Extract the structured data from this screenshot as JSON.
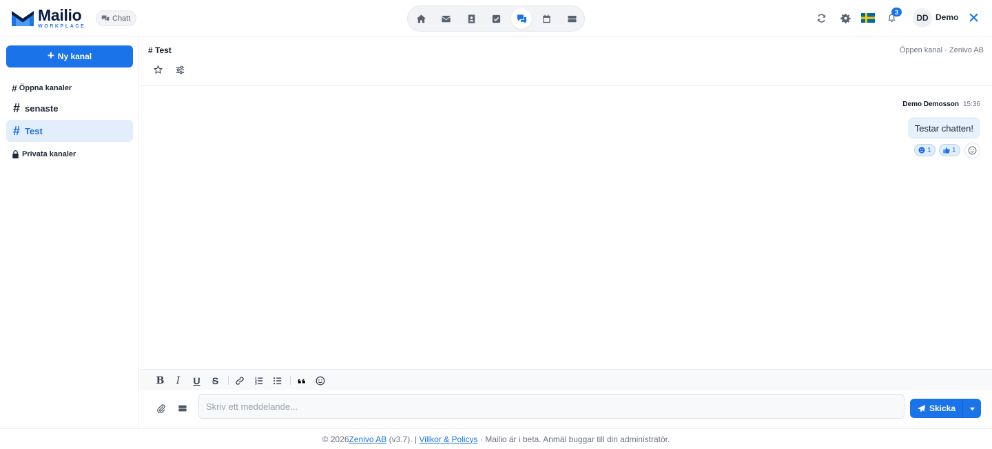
{
  "brand": {
    "name": "Mailio",
    "tagline": "WORKPLACE",
    "app_badge": "Chatt",
    "colors": {
      "primary": "#1a73e8",
      "brand_dark": "#0b1b3f"
    }
  },
  "nav": {
    "items": [
      {
        "id": "home",
        "icon": "home-icon"
      },
      {
        "id": "mail",
        "icon": "envelope-icon"
      },
      {
        "id": "contacts",
        "icon": "contacts-icon"
      },
      {
        "id": "tasks",
        "icon": "checkbox-icon"
      },
      {
        "id": "chat",
        "icon": "chat-bubbles-icon",
        "active": true
      },
      {
        "id": "calendar",
        "icon": "calendar-icon"
      },
      {
        "id": "storage",
        "icon": "storage-icon"
      }
    ]
  },
  "header_right": {
    "notification_count": "3",
    "language_flag": "flag-sweden-icon",
    "user": {
      "initials": "DD",
      "name": "Demo"
    }
  },
  "sidebar": {
    "new_channel_label": "Ny kanal",
    "open_section_label": "Öppna kanaler",
    "channels": [
      {
        "name": "senaste",
        "active": false
      },
      {
        "name": "Test",
        "active": true
      }
    ],
    "private_section_label": "Privata kanaler"
  },
  "channel": {
    "title": "# Test",
    "meta": "Öppen kanal · Zenivo AB"
  },
  "messages": [
    {
      "author": "Demo Demosson",
      "time": "15:36",
      "text": "Testar chatten!",
      "reactions": [
        {
          "icon": "smiley-icon",
          "count": "1"
        },
        {
          "icon": "thumbs-up-icon",
          "count": "1"
        }
      ]
    }
  ],
  "composer": {
    "placeholder": "Skriv ett meddelande...",
    "send_label": "Skicka"
  },
  "footer": {
    "copyright": "© 2026 ",
    "company_link": "Zenivo AB",
    "version": " (v3.7). | ",
    "terms_link": "Villkor & Policys",
    "notice": " · Mailio är i beta. Anmäl buggar till din administratör."
  }
}
